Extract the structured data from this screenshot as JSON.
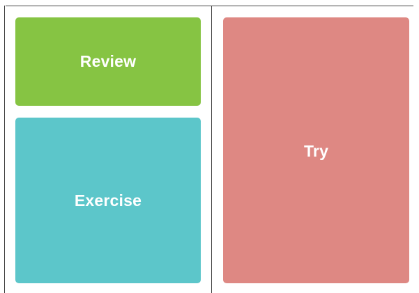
{
  "tiles": {
    "review": {
      "label": "Review",
      "color": "#86c443"
    },
    "exercise": {
      "label": "Exercise",
      "color": "#5cc6ca"
    },
    "try": {
      "label": "Try",
      "color": "#de8883"
    }
  },
  "colors": {
    "background": "#ffffff",
    "rule": "#444444",
    "text": "#ffffff"
  }
}
